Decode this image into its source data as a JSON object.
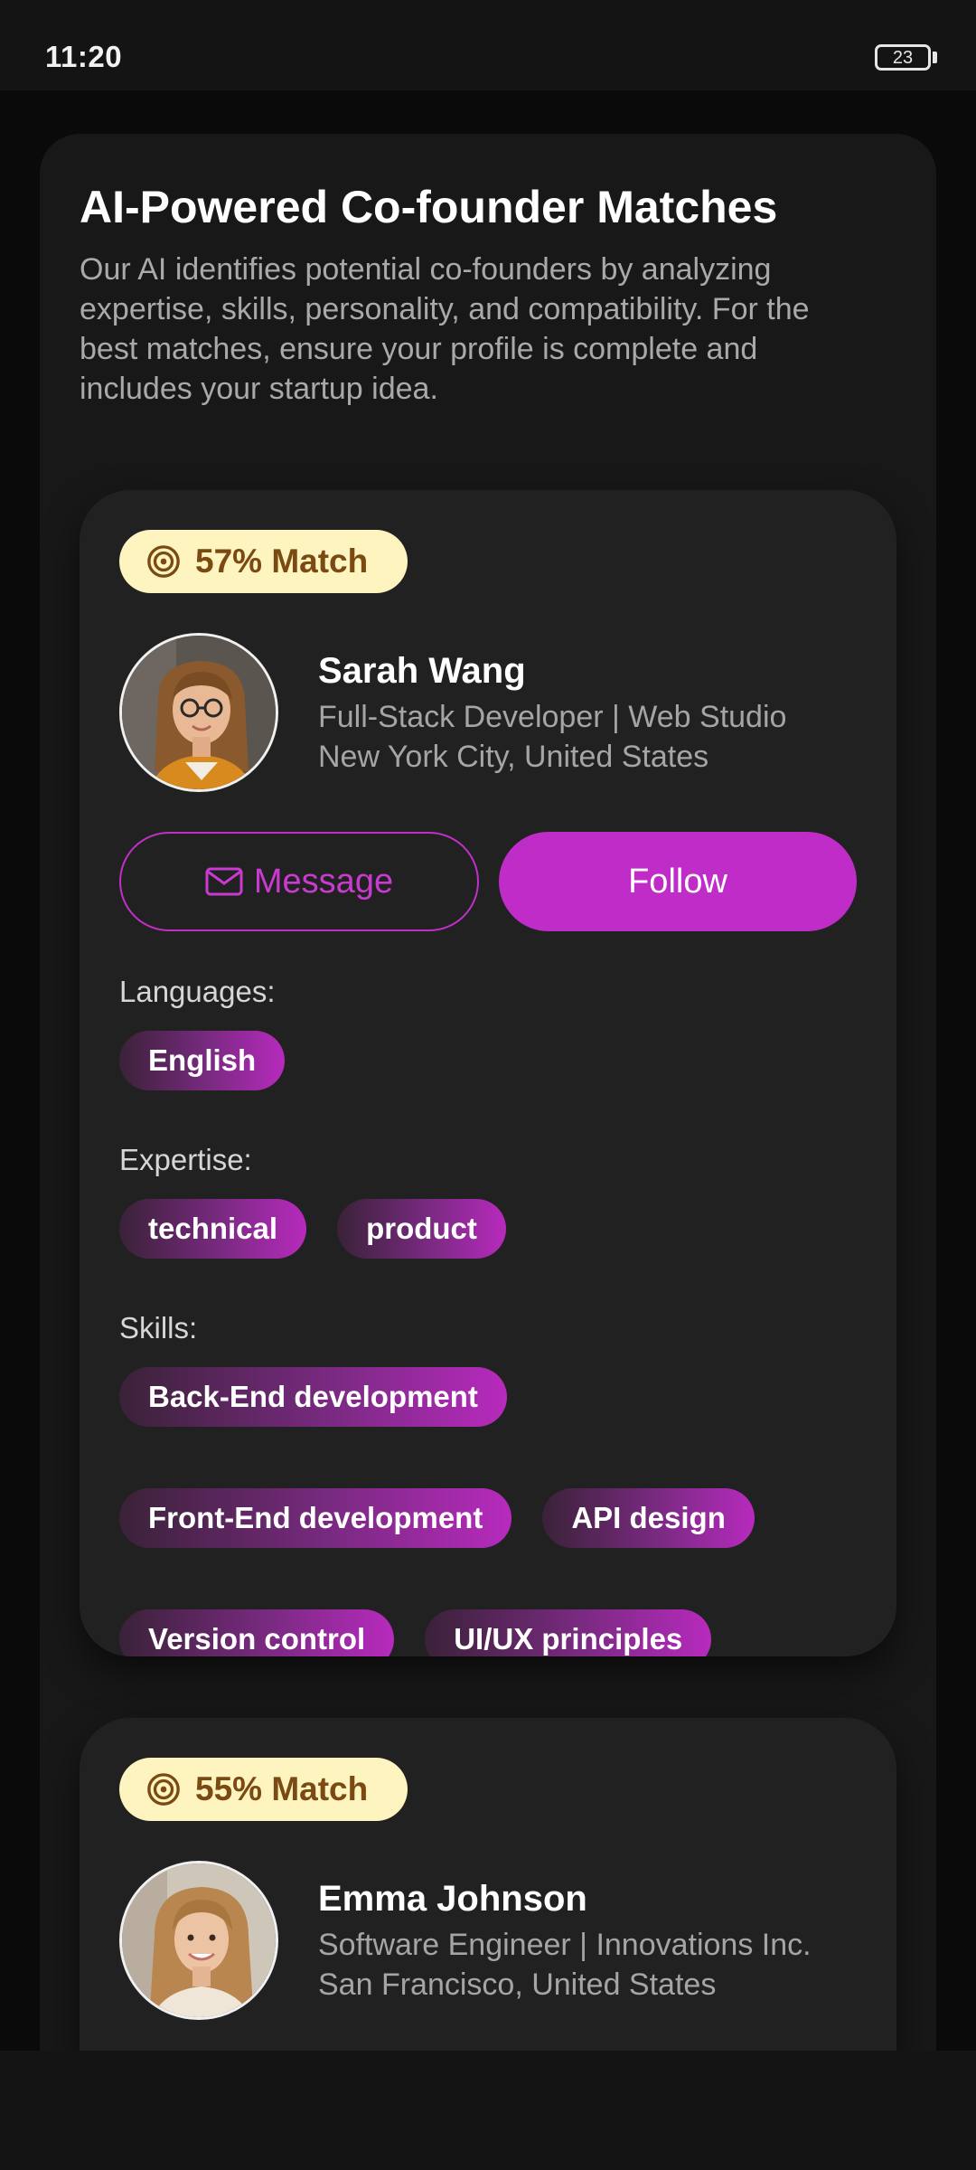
{
  "status_bar": {
    "time": "11:20",
    "battery": "23"
  },
  "section": {
    "title": "AI-Powered Co-founder Matches",
    "description": "Our AI identifies potential co-founders by analyzing expertise, skills, personality, and compatibility. For the best matches, ensure your profile is complete and includes your startup idea."
  },
  "matches": [
    {
      "match": "57% Match",
      "name": "Sarah Wang",
      "role": "Full-Stack Developer | Web Studio",
      "location": "New York City, United States",
      "message_label": "Message",
      "follow_label": "Follow",
      "languages_label": "Languages:",
      "languages": [
        "English"
      ],
      "expertise_label": "Expertise:",
      "expertise": [
        "technical",
        "product"
      ],
      "skills_label": "Skills:",
      "skills": [
        "Back-End development",
        "Front-End development",
        "API design",
        "Version control",
        "UI/UX principles"
      ]
    },
    {
      "match": "55% Match",
      "name": "Emma Johnson",
      "role": "Software Engineer | Innovations Inc.",
      "location": "San Francisco, United States"
    }
  ],
  "colors": {
    "accent": "#bf2cc7",
    "badge_bg": "#fdf4c0",
    "badge_text": "#7a4a12",
    "card_bg": "#212121"
  }
}
